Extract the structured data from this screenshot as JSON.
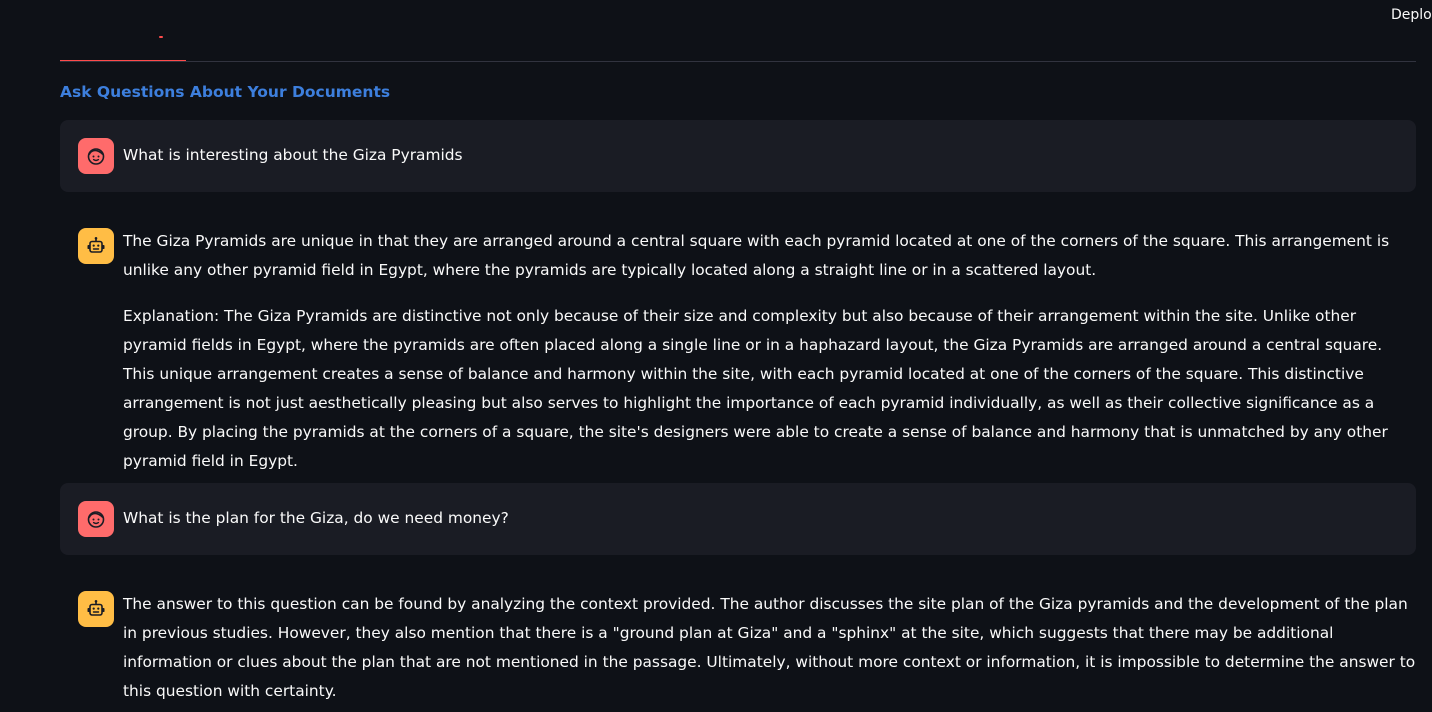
{
  "header": {
    "deploy_label": "Deploy"
  },
  "tabs": {
    "active_label": ""
  },
  "main": {
    "subheader": "Ask Questions About Your Documents"
  },
  "chat": {
    "messages": [
      {
        "role": "user",
        "avatar_icon": "face-icon",
        "paragraphs": [
          "What is interesting about the Giza Pyramids"
        ]
      },
      {
        "role": "assistant",
        "avatar_icon": "robot-icon",
        "paragraphs": [
          "The Giza Pyramids are unique in that they are arranged around a central square with each pyramid located at one of the corners of the square. This arrangement is unlike any other pyramid field in Egypt, where the pyramids are typically located along a straight line or in a scattered layout.",
          "Explanation: The Giza Pyramids are distinctive not only because of their size and complexity but also because of their arrangement within the site. Unlike other pyramid fields in Egypt, where the pyramids are often placed along a single line or in a haphazard layout, the Giza Pyramids are arranged around a central square. This unique arrangement creates a sense of balance and harmony within the site, with each pyramid located at one of the corners of the square. This distinctive arrangement is not just aesthetically pleasing but also serves to highlight the importance of each pyramid individually, as well as their collective significance as a group. By placing the pyramids at the corners of a square, the site's designers were able to create a sense of balance and harmony that is unmatched by any other pyramid field in Egypt."
        ]
      },
      {
        "role": "user",
        "avatar_icon": "face-icon",
        "paragraphs": [
          "What is the plan for the Giza, do we need money?"
        ]
      },
      {
        "role": "assistant",
        "avatar_icon": "robot-icon",
        "paragraphs": [
          "The answer to this question can be found by analyzing the context provided. The author discusses the site plan of the Giza pyramids and the development of the plan in previous studies. However, they also mention that there is a \"ground plan at Giza\" and a \"sphinx\" at the site, which suggests that there may be additional information or clues about the plan that are not mentioned in the passage. Ultimately, without more context or information, it is impossible to determine the answer to this question with certainty."
        ]
      }
    ]
  },
  "colors": {
    "background": "#0e1117",
    "user_bubble": "#1a1c24",
    "user_avatar": "#ff6b6b",
    "assistant_avatar": "#ffbd45",
    "tab_accent": "#ff4b4b",
    "subheader": "#3d7fdd"
  }
}
